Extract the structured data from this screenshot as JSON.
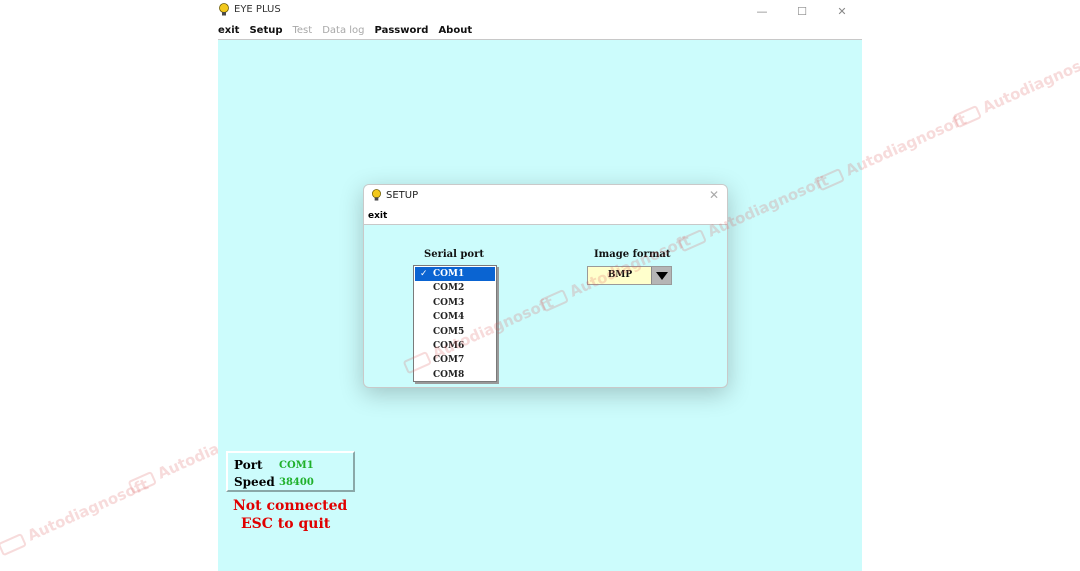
{
  "window": {
    "title": "EYE PLUS",
    "controls": {
      "minimize": "—",
      "maximize": "☐",
      "close": "✕"
    }
  },
  "menubar": {
    "exit": "exit",
    "setup": "Setup",
    "test": "Test",
    "data_log": "Data log",
    "password": "Password",
    "about": "About"
  },
  "dialog": {
    "title": "SETUP",
    "close": "✕",
    "menu_exit": "exit",
    "serial_port_label": "Serial port",
    "image_format_label": "Image format",
    "ports": [
      "COM1",
      "COM2",
      "COM3",
      "COM4",
      "COM5",
      "COM6",
      "COM7",
      "COM8"
    ],
    "selected_port": "COM1",
    "check_mark": "✓",
    "image_format_value": "BMP",
    "selection_color": "#0a64d2",
    "format_bg_color": "#ffffcc"
  },
  "status": {
    "port_label": "Port",
    "port_value": "COM1",
    "speed_label": "Speed",
    "speed_value": "38400",
    "message_1": "Not connected",
    "message_2": "ESC to quit",
    "value_color": "#1fb02a",
    "message_color": "#e00000"
  },
  "watermark": {
    "text": "Autodiagnosoft"
  },
  "colors": {
    "client_bg": "#ccfcfc"
  }
}
